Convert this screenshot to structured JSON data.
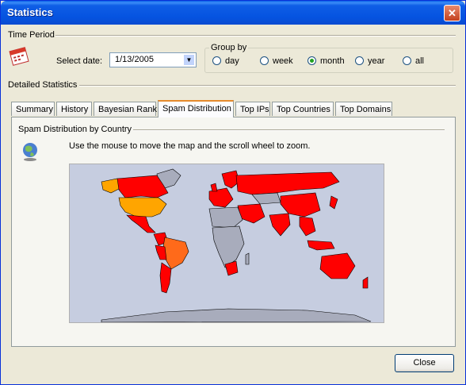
{
  "window": {
    "title": "Statistics",
    "close_glyph": "✕"
  },
  "time_period": {
    "section_label": "Time Period",
    "select_date_label": "Select date:",
    "date_value": "1/13/2005",
    "calendar_icon": "calendar-icon"
  },
  "group_by": {
    "label": "Group by",
    "options": [
      {
        "label": "day",
        "selected": false
      },
      {
        "label": "week",
        "selected": false
      },
      {
        "label": "month",
        "selected": true
      },
      {
        "label": "year",
        "selected": false
      },
      {
        "label": "all",
        "selected": false
      }
    ]
  },
  "detailed": {
    "section_label": "Detailed Statistics",
    "tabs": [
      {
        "label": "Summary",
        "active": false
      },
      {
        "label": "History",
        "active": false
      },
      {
        "label": "Bayesian Rank",
        "active": false
      },
      {
        "label": "Spam Distribution",
        "active": true
      },
      {
        "label": "Top IPs",
        "active": false
      },
      {
        "label": "Top Countries",
        "active": false
      },
      {
        "label": "Top Domains",
        "active": false
      }
    ]
  },
  "spam_panel": {
    "label": "Spam Distribution by Country",
    "hint": "Use the mouse to move the map and the scroll wheel to zoom.",
    "globe_icon": "globe-icon",
    "colors": {
      "ocean": "#c6cde0",
      "high": "#ff0000",
      "medium": "#ff8c1a",
      "top": "#ffa500",
      "none": "#a8acbc"
    }
  },
  "buttons": {
    "close": "Close"
  }
}
